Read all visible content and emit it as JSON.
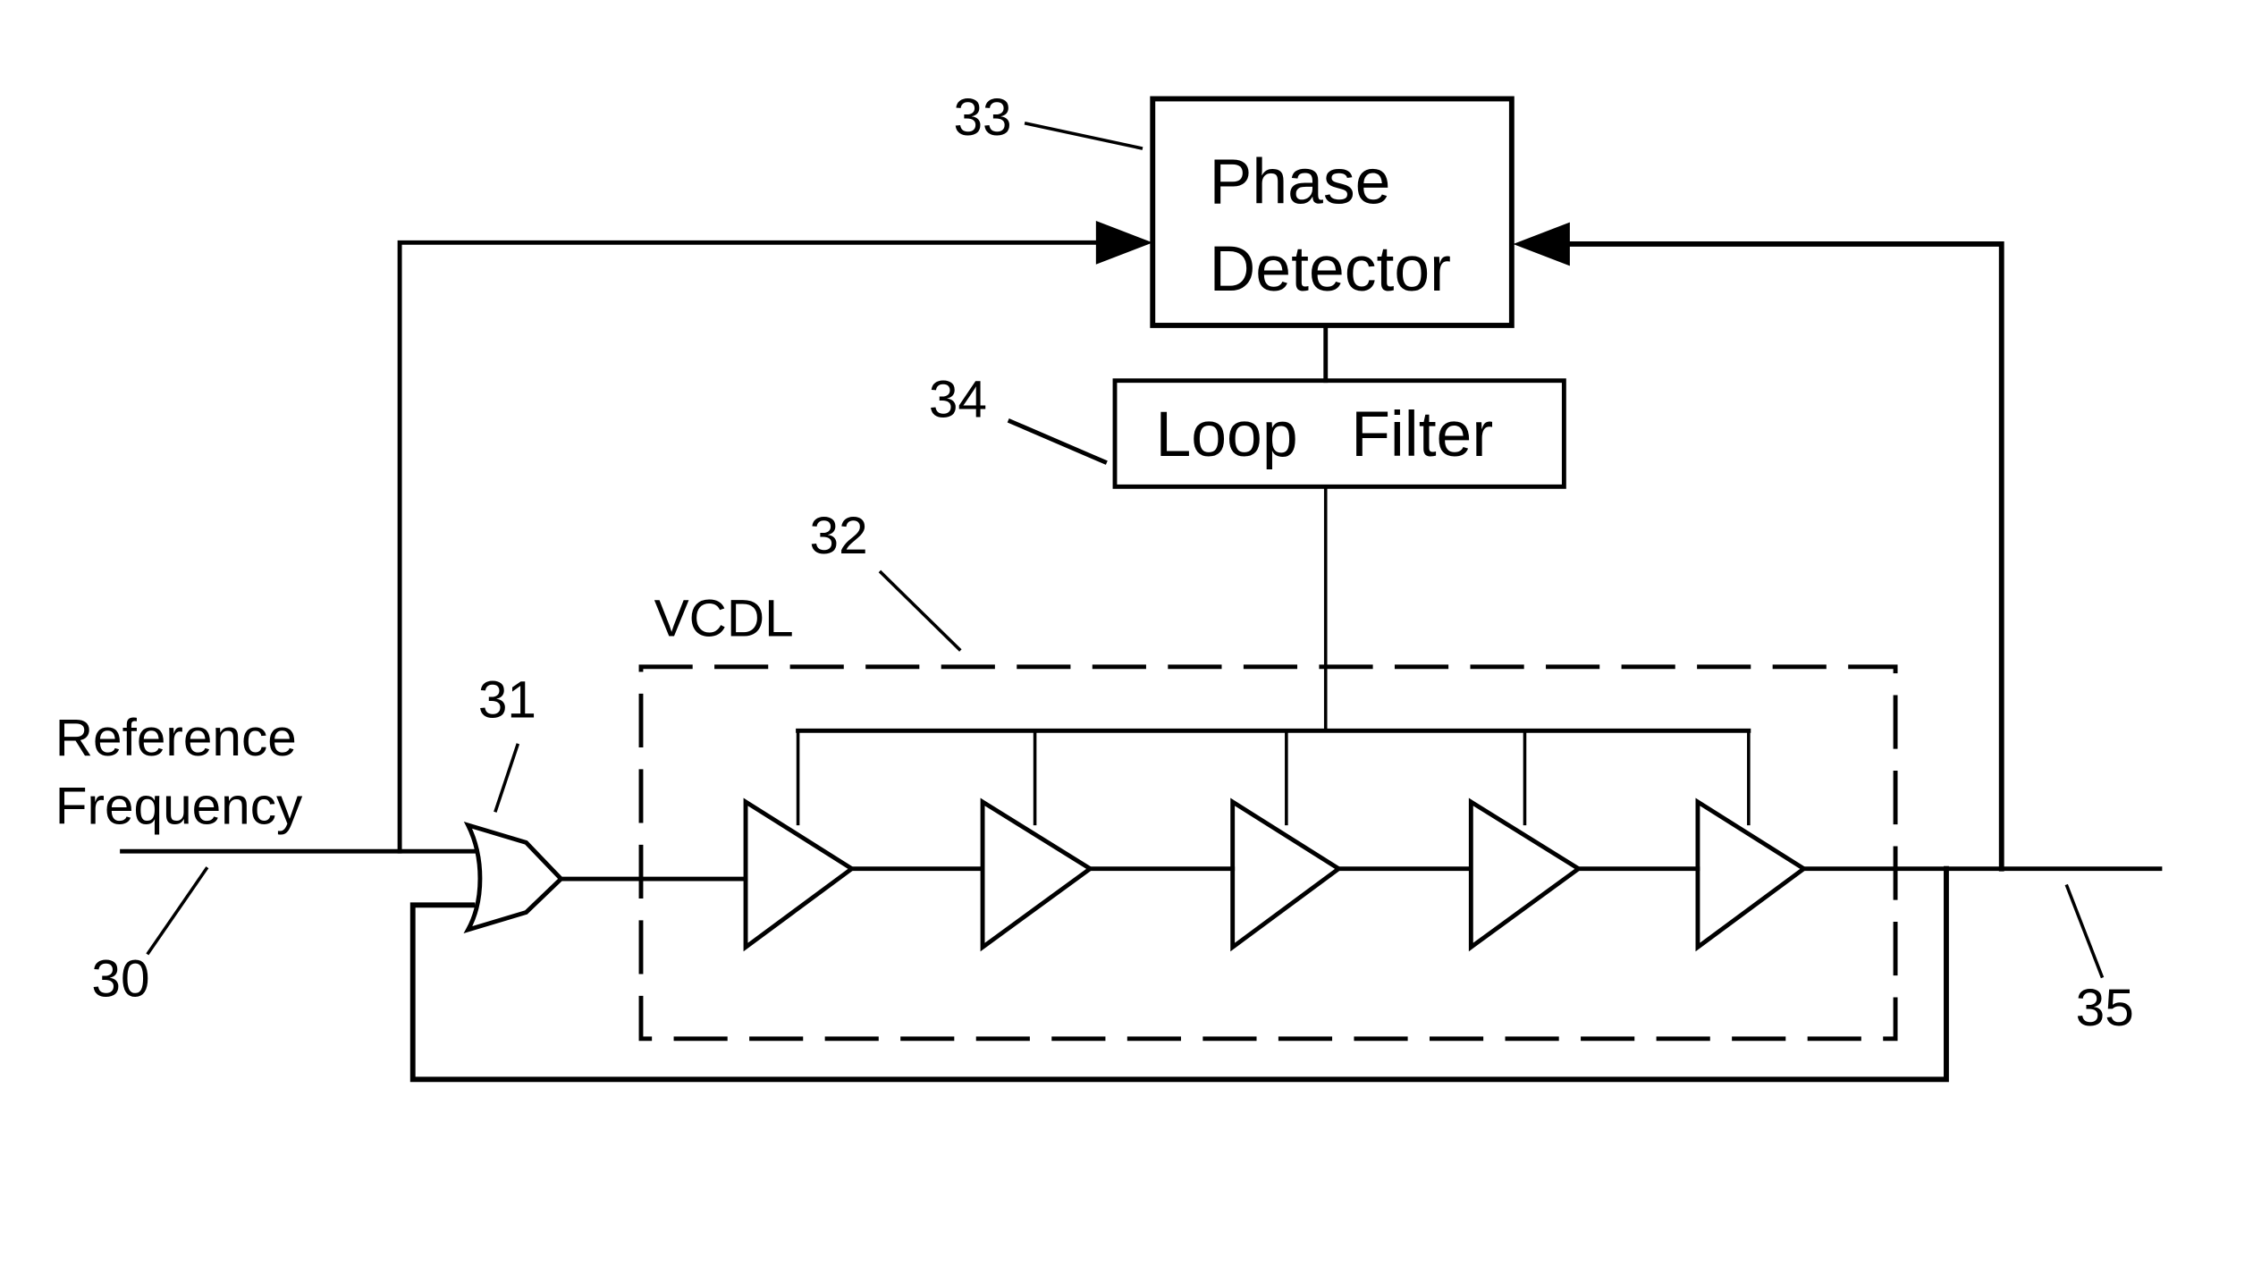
{
  "diagram": {
    "type": "block-diagram",
    "subject": "Delay-locked loop with voltage-controlled delay line",
    "colors": {
      "line": "#000000",
      "background": "#ffffff"
    },
    "blocks": {
      "phase_detector": {
        "line1": "Phase",
        "line2": "Detector",
        "ref": "33"
      },
      "loop_filter": {
        "label": "Loop   Filter",
        "ref": "34"
      },
      "vcdl": {
        "label": "VCDL",
        "ref": "32"
      },
      "mux": {
        "ref": "31"
      }
    },
    "input": {
      "line1": "Reference",
      "line2": "Frequency",
      "ref": "30"
    },
    "output": {
      "ref": "35"
    },
    "delay_stage_count": 5,
    "delay_stages": [
      {
        "name": "delay-stage-1"
      },
      {
        "name": "delay-stage-2"
      },
      {
        "name": "delay-stage-3"
      },
      {
        "name": "delay-stage-4"
      },
      {
        "name": "delay-stage-5"
      }
    ],
    "connections": [
      {
        "from": "reference-frequency",
        "to": "mux"
      },
      {
        "from": "reference-frequency",
        "to": "phase-detector"
      },
      {
        "from": "mux",
        "to": "vcdl"
      },
      {
        "from": "phase-detector",
        "to": "loop-filter"
      },
      {
        "from": "loop-filter",
        "to": "vcdl-control"
      },
      {
        "from": "vcdl",
        "to": "output"
      },
      {
        "from": "output",
        "to": "phase-detector"
      },
      {
        "from": "output",
        "to": "mux"
      }
    ]
  }
}
